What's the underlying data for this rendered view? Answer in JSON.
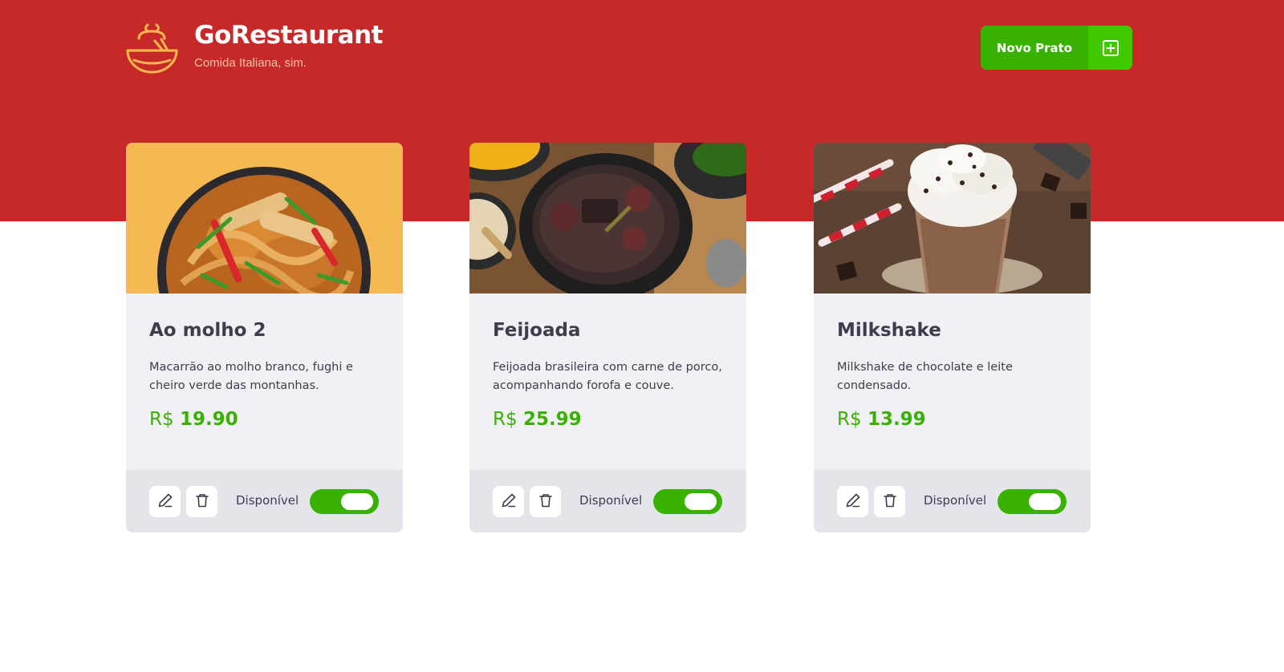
{
  "header": {
    "title": "GoRestaurant",
    "subtitle": "Comida Italiana, sim.",
    "new_dish_label": "Novo Prato",
    "logo_icon": "bowl-icon",
    "add_icon": "plus-square-icon"
  },
  "colors": {
    "header_bg": "#c72828",
    "accent_green": "#39b100",
    "card_bg": "#f0f0f5",
    "card_footer_bg": "#e4e4eb",
    "text": "#3d3d4d"
  },
  "dishes": [
    {
      "name": "Ao molho 2",
      "description": "Macarrão ao molho branco, fughi e cheiro verde das montanhas.",
      "currency": "R$",
      "price": "19.90",
      "available_label": "Disponível",
      "available": true
    },
    {
      "name": "Feijoada",
      "description": "Feijoada brasileira com carne de porco, acompanhando forofa e couve.",
      "currency": "R$",
      "price": "25.99",
      "available_label": "Disponível",
      "available": true
    },
    {
      "name": "Milkshake",
      "description": "Milkshake de chocolate e leite condensado.",
      "currency": "R$",
      "price": "13.99",
      "available_label": "Disponível",
      "available": true
    }
  ]
}
